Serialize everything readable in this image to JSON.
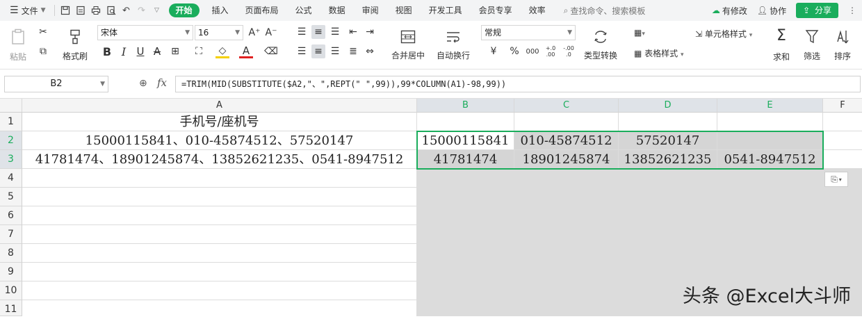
{
  "topbar": {
    "file_label": "文件",
    "tabs": [
      "开始",
      "插入",
      "页面布局",
      "公式",
      "数据",
      "审阅",
      "视图",
      "开发工具",
      "会员专享",
      "效率"
    ],
    "active_tab": "开始",
    "search_placeholder": "查找命令、搜索模板",
    "has_changes": "有修改",
    "collab": "协作",
    "share": "分享"
  },
  "ribbon": {
    "paste": "粘贴",
    "format_painter": "格式刷",
    "font_name": "宋体",
    "font_size": "16",
    "merge_center": "合并居中",
    "wrap_text": "自动换行",
    "number_format": "常规",
    "type_convert": "类型转换",
    "cond_format": "条件格式",
    "cell_style": "单元格样式",
    "table_style": "表格样式",
    "sum": "求和",
    "filter": "筛选",
    "sort": "排序",
    "currency_symbol": "¥",
    "percent_symbol": "%",
    "thousands": "000",
    "dec_inc": "+.0 .00",
    "dec_dec": "-.00 .0"
  },
  "formula_bar": {
    "name_box": "B2",
    "formula": "=TRIM(MID(SUBSTITUTE($A2,\"、\",REPT(\" \",99)),99*COLUMN(A1)-98,99))"
  },
  "columns": [
    "A",
    "B",
    "C",
    "D",
    "E",
    "F"
  ],
  "rows": [
    "1",
    "2",
    "3",
    "4",
    "5",
    "6",
    "7",
    "8",
    "9",
    "10",
    "11"
  ],
  "cells": {
    "A1": "手机号/座机号",
    "A2": "15000115841、010-45874512、57520147",
    "A3": "41781474、18901245874、13852621235、0541-8947512",
    "B2": "15000115841",
    "C2": "010-45874512",
    "D2": "57520147",
    "E2": "",
    "B3": "41781474",
    "C3": "18901245874",
    "D3": "13852621235",
    "E3": "0541-8947512"
  },
  "watermark": "头条 @Excel大斗师",
  "colors": {
    "accent": "#1aad5c",
    "selection_fill": "#d5d5d5"
  }
}
